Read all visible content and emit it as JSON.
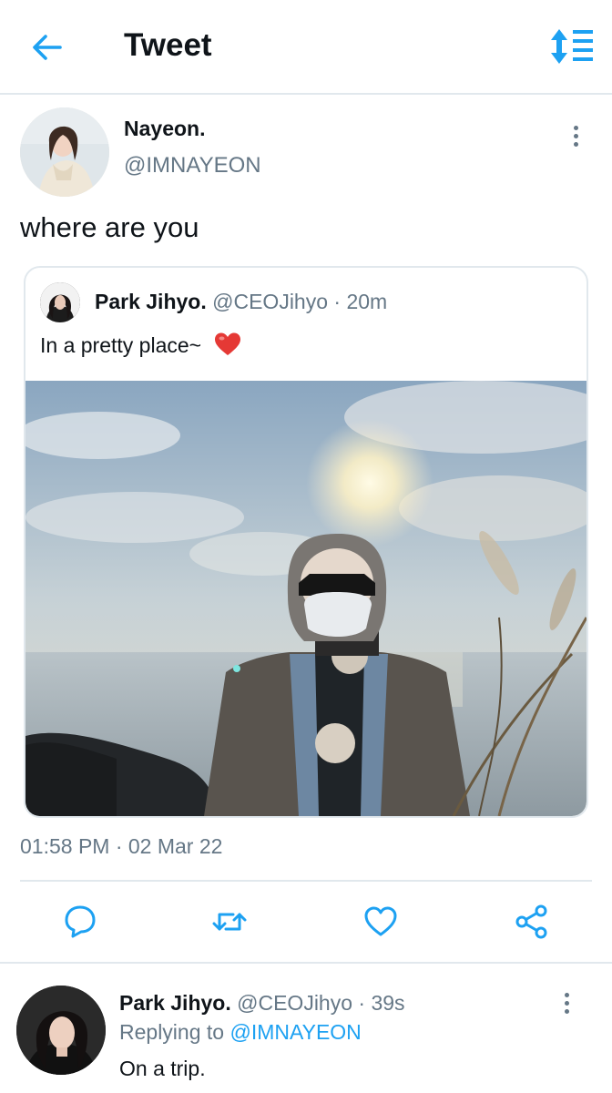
{
  "header": {
    "title": "Tweet",
    "back_icon": "arrow-left-icon",
    "sort_icon": "sort-lines-icon",
    "accent_color": "#1da1f2"
  },
  "tweet": {
    "author_name": "Nayeon.",
    "author_handle": "@IMNAYEON",
    "text": "where are you",
    "timestamp": "01:58 PM · 02 Mar 22",
    "more_icon": "more-vertical-icon"
  },
  "quoted_tweet": {
    "author_name": "Park Jihyo.",
    "author_handle": "@CEOJihyo",
    "time": "· 20m",
    "text": "In a pretty place~",
    "emoji": "red-heart-emoji"
  },
  "actions": [
    {
      "name": "reply",
      "icon": "comment-icon"
    },
    {
      "name": "retweet",
      "icon": "retweet-icon"
    },
    {
      "name": "like",
      "icon": "heart-icon"
    },
    {
      "name": "share",
      "icon": "share-icon"
    }
  ],
  "reply": {
    "author_name": "Park Jihyo.",
    "author_handle": "@CEOJihyo",
    "time": "· 39s",
    "replying_prefix": "Replying to",
    "replying_handle": "@IMNAYEON",
    "text": "On a trip."
  }
}
